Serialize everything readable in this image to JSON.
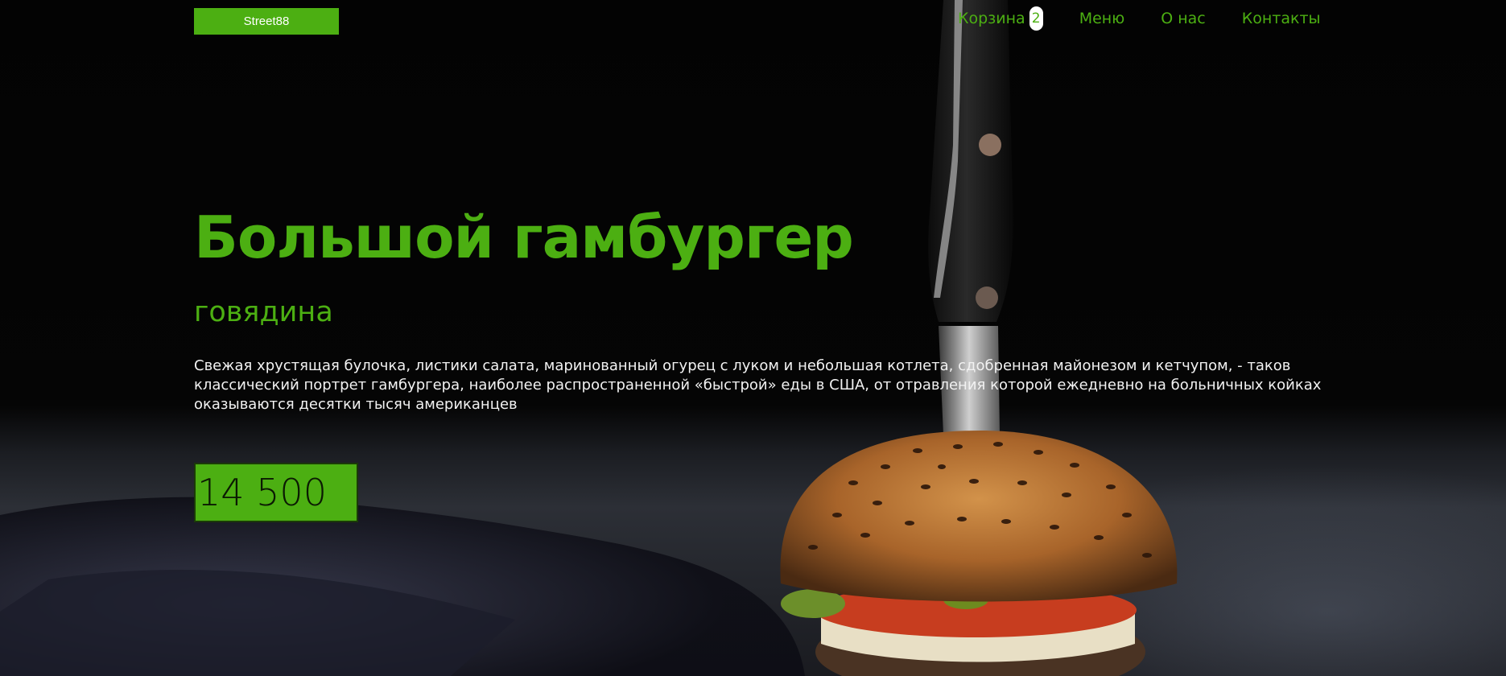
{
  "header": {
    "logo_label": "Street88",
    "nav": {
      "cart_label": "Корзина",
      "cart_count": "2",
      "menu_label": "Меню",
      "about_label": "О нас",
      "contacts_label": "Контакты"
    }
  },
  "hero": {
    "title": "Большой гамбургер",
    "subtitle": "говядина",
    "description": "Свежая хрустящая булочка, листики салата, маринованный огурец с луком и небольшая котлета, сдобренная майонезом и кетчупом, - таков классический портрет гамбургера, наиболее распространенной «быстрой» еды в США, от отравления которой ежедневно на больничных койках оказываются десятки тысяч американцев",
    "price": "14 500"
  },
  "colors": {
    "accent": "#4caf12",
    "background": "#000000",
    "text": "#f2f2f2"
  }
}
